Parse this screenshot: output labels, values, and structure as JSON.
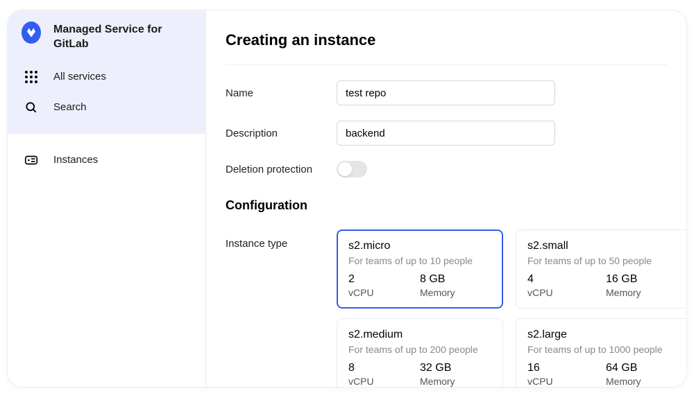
{
  "sidebar": {
    "heading": "Managed Service for GitLab",
    "all_services": "All services",
    "search": "Search",
    "instances": "Instances"
  },
  "page": {
    "title": "Creating an instance",
    "name_label": "Name",
    "description_label": "Description",
    "protection_label": "Deletion protection",
    "config_title": "Configuration",
    "instance_type_label": "Instance type"
  },
  "form": {
    "name_value": "test repo",
    "description_value": "backend",
    "protection_on": false
  },
  "spec_labels": {
    "vcpu": "vCPU",
    "memory": "Memory"
  },
  "instance_types": [
    {
      "id": "s2.micro",
      "title": "s2.micro",
      "subtitle": "For teams of up to 10 people",
      "vcpu": "2",
      "memory": "8 GB",
      "selected": true
    },
    {
      "id": "s2.small",
      "title": "s2.small",
      "subtitle": "For teams of up to 50 people",
      "vcpu": "4",
      "memory": "16 GB",
      "selected": false
    },
    {
      "id": "s2.medium",
      "title": "s2.medium",
      "subtitle": "For teams of up to 200 people",
      "vcpu": "8",
      "memory": "32 GB",
      "selected": false
    },
    {
      "id": "s2.large",
      "title": "s2.large",
      "subtitle": "For teams of up to 1000 people",
      "vcpu": "16",
      "memory": "64 GB",
      "selected": false
    }
  ]
}
